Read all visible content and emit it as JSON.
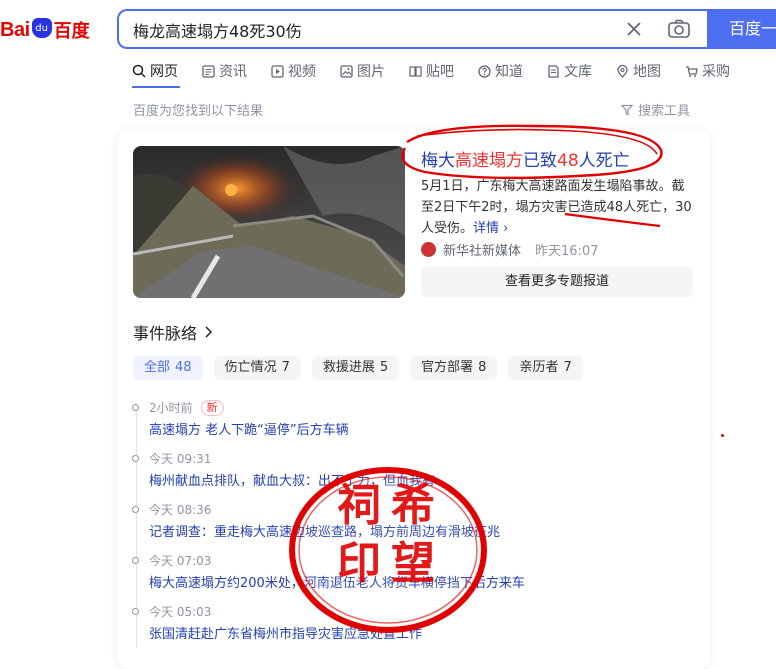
{
  "header": {
    "logo_text_latin": "Bai",
    "logo_paw_text": "du",
    "logo_text_cn": "百度",
    "search_value": "梅龙高速塌方48死30伤",
    "search_button": "百度一下"
  },
  "tabs": [
    {
      "label": "网页",
      "icon": "search-icon"
    },
    {
      "label": "资讯",
      "icon": "news-icon"
    },
    {
      "label": "视频",
      "icon": "video-icon"
    },
    {
      "label": "图片",
      "icon": "image-icon"
    },
    {
      "label": "贴吧",
      "icon": "tieba-icon"
    },
    {
      "label": "知道",
      "icon": "question-icon"
    },
    {
      "label": "文库",
      "icon": "doc-icon"
    },
    {
      "label": "地图",
      "icon": "map-icon"
    },
    {
      "label": "采购",
      "icon": "cart-icon"
    }
  ],
  "results_info": "百度为您找到以下结果",
  "search_tools": "搜索工具",
  "news": {
    "title_parts": [
      "梅大",
      "高速塌方",
      "已致",
      "48",
      "人死亡"
    ],
    "summary": "5月1日，广东梅大高速路面发生塌陷事故。截至2日下午2时，塌方灾害已造成48人死亡，30人受伤。",
    "detail_link": "详情",
    "source_name": "新华社新媒体",
    "source_time": "昨天16:07",
    "more_button": "查看更多专题报道"
  },
  "timeline": {
    "title": "事件脉络",
    "filters": [
      {
        "label": "全部",
        "count": "48"
      },
      {
        "label": "伤亡情况",
        "count": "7"
      },
      {
        "label": "救援进展",
        "count": "5"
      },
      {
        "label": "官方部署",
        "count": "8"
      },
      {
        "label": "亲历者",
        "count": "7"
      }
    ],
    "items": [
      {
        "time": "2小时前",
        "badge": "新",
        "text": "高速塌方 老人下跪“逼停”后方车辆"
      },
      {
        "time": "今天 09:31",
        "text": "梅州献血点排队，献血大叔：出不了力，但血我有"
      },
      {
        "time": "今天 08:36",
        "text": "记者调查：重走梅大高速边坡巡查路，塌方前周边有滑坡征兆"
      },
      {
        "time": "今天 07:03",
        "text": "梅大高速塌方约200米处，河南退伍老人将货车横停挡下后方来车"
      },
      {
        "time": "今天 05:03",
        "text": "张国清赶赴广东省梅州市指导灾害应急处置工作"
      }
    ]
  },
  "stamp": {
    "line1": "祠希",
    "line2": "印望"
  },
  "colors": {
    "brand_blue": "#4e6ef2",
    "link_blue": "#2440b3",
    "highlight_red": "#f73131",
    "stamp_red": "#e00000"
  }
}
